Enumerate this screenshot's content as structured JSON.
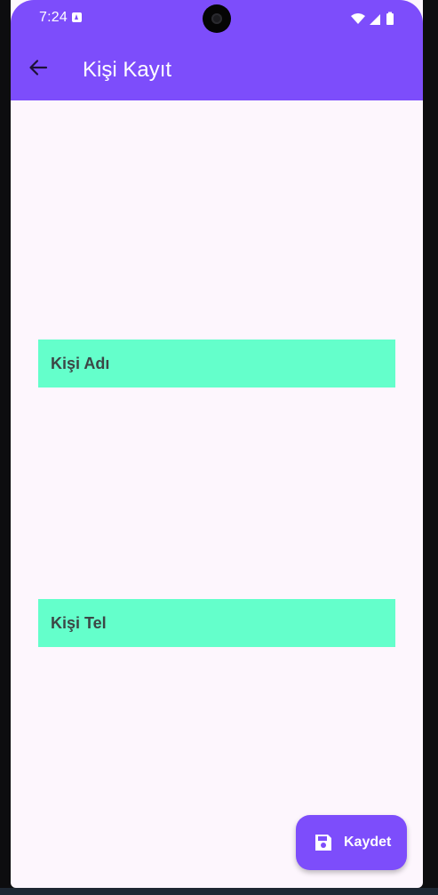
{
  "status_bar": {
    "time": "7:24",
    "notification_icon": "android-notification-icon",
    "icons": [
      "wifi-icon",
      "signal-icon",
      "battery-icon"
    ]
  },
  "app_bar": {
    "title": "Kişi Kayıt",
    "back_icon": "arrow-back-icon",
    "color": "#7d4dfb"
  },
  "form": {
    "name_field": {
      "placeholder": "Kişi Adı",
      "value": ""
    },
    "phone_field": {
      "placeholder": "Kişi Tel",
      "value": ""
    },
    "field_color": "#64ffcb"
  },
  "fab": {
    "label": "Kaydet",
    "icon": "save-icon",
    "color": "#7d4dfb"
  },
  "colors": {
    "accent": "#7d4dfb",
    "background": "#fdf6fd",
    "field": "#64ffcb"
  }
}
